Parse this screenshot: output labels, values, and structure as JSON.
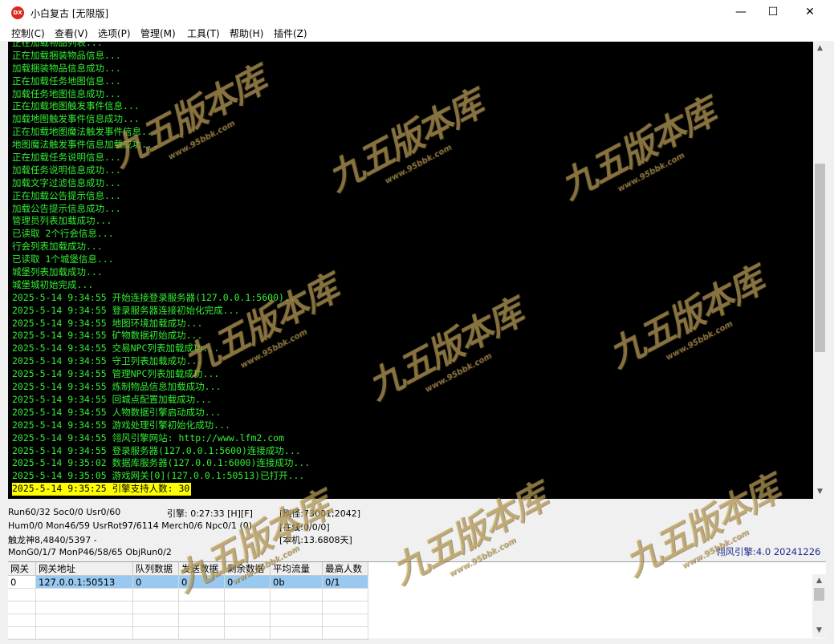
{
  "window": {
    "title": "小白复古 [无限版]",
    "icon_text": "DX",
    "controls": {
      "minimize": "—",
      "maximize": "☐",
      "close": "✕"
    }
  },
  "menu": [
    "控制(C)",
    "查看(V)",
    "选项(P)",
    "管理(M)",
    "工具(T)",
    "帮助(H)",
    "插件(Z)"
  ],
  "console": {
    "lines": [
      "正在加载物品列表...",
      "正在加载捆装物品信息...",
      "加载捆装物品信息成功...",
      "正在加载任务地图信息...",
      "加载任务地图信息成功...",
      "正在加载地图触发事件信息...",
      "加载地图触发事件信息成功...",
      "正在加载地图魔法触发事件信息...",
      "地图魔法触发事件信息加载成功...",
      "正在加载任务说明信息...",
      "加载任务说明信息成功...",
      "加载文字过滤信息成功...",
      "正在加载公告提示信息...",
      "加载公告提示信息成功...",
      "管理员列表加载成功...",
      "已读取 2个行会信息...",
      "行会列表加载成功...",
      "已读取 1个城堡信息...",
      "城堡列表加载成功...",
      "城堡城初始完成...",
      "2025-5-14 9:34:55 开始连接登录服务器(127.0.0.1:5600)...",
      "2025-5-14 9:34:55 登录服务器连接初始化完成...",
      "2025-5-14 9:34:55 地图环境加载成功...",
      "2025-5-14 9:34:55 矿物数据初始成功...",
      "2025-5-14 9:34:55 交易NPC列表加载成功...",
      "2025-5-14 9:34:55 守卫列表加载成功...",
      "2025-5-14 9:34:55 管理NPC列表加载成功...",
      "2025-5-14 9:34:55 炼制物品信息加载成功...",
      "2025-5-14 9:34:55 回城点配置加载成功...",
      "2025-5-14 9:34:55 人物数据引擎启动成功...",
      "2025-5-14 9:34:55 游戏处理引擎初始化成功...",
      "2025-5-14 9:34:55 翎风引擎网站: http://www.lfm2.com",
      "2025-5-14 9:34:55 登录服务器(127.0.0.1:5600)连接成功...",
      "2025-5-14 9:35:02 数据库服务器(127.0.0.1:6000)连接成功...",
      "2025-5-14 9:35:05 游戏网关[0](127.0.0.1:50513)已打开...",
      "2025-5-14 9:35:25 引擎支持人数: 30"
    ],
    "highlighted_index": 35
  },
  "status": {
    "run": "Run60/32 Soc0/0 Usr0/60",
    "engine_time": "引擎: 0:27:33 [H][F]",
    "refresh": "[刷怪:73001;2042]",
    "hum": "Hum0/0 Mon46/59 UsrRot97/6114 Merch0/6 Npc0/1 (0)",
    "online": "[在线:0/0/0]",
    "boss": "触龙神8,4840/5397 -",
    "local": "[本机:13.6808天]",
    "mon": "MonG0/1/7 MonP46/58/65 ObjRun0/2",
    "version": "翎风引擎:4.0 20241226"
  },
  "gateway_table": {
    "headers": [
      "网关",
      "网关地址",
      "队列数据",
      "发送数据",
      "剩余数据",
      "平均流量",
      "最高人数"
    ],
    "rows": [
      [
        "0",
        "127.0.0.1:50513",
        "0",
        "0",
        "0",
        "0b",
        "0/1"
      ]
    ]
  },
  "watermark": {
    "text": "九五版本库",
    "url": "www.95bbk.com"
  }
}
